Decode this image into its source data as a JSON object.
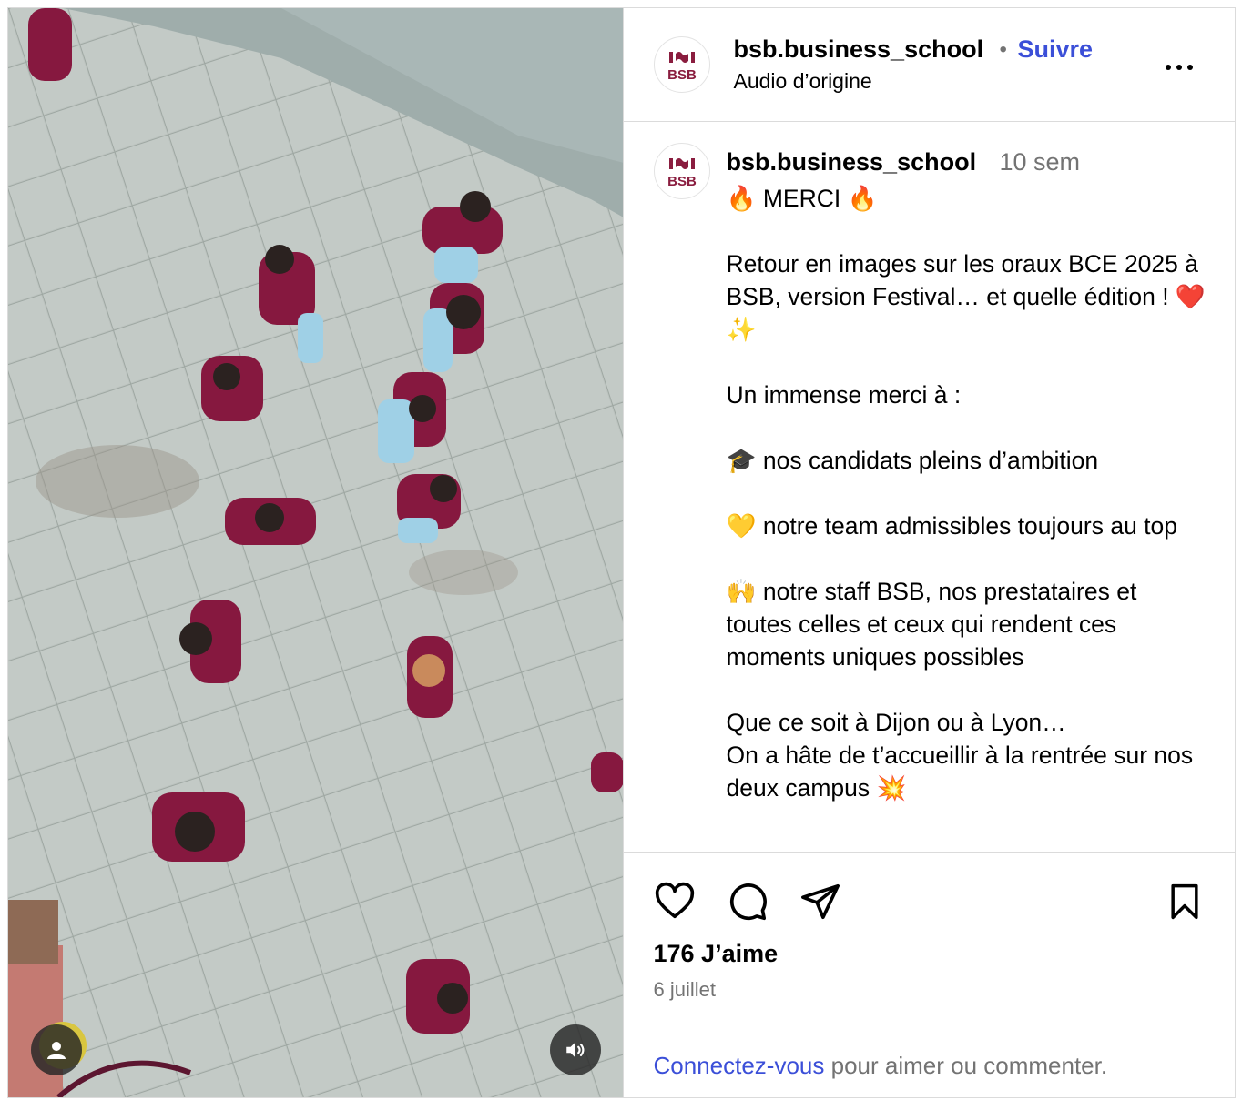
{
  "header": {
    "username": "bsb.business_school",
    "separator": "•",
    "follow_label": "Suivre",
    "audio_label": "Audio d’origine",
    "more_icon": "more-horizontal-icon"
  },
  "avatar": {
    "logo_text": "BSB",
    "brand_color": "#8a1d3f"
  },
  "caption": {
    "username": "bsb.business_school",
    "time": "10 sem",
    "text": "🔥 MERCI 🔥\n\nRetour en images sur les oraux BCE 2025 à BSB, version Festival… et quelle édition ! ❤️✨\n\nUn immense merci à :\n\n🎓 nos candidats pleins d’ambition\n\n💛 notre team admissibles toujours au top\n\n🙌 notre staff BSB, nos prestataires et toutes celles et ceux qui rendent ces moments uniques possibles\n\nQue ce soit à Dijon ou à Lyon…\nOn a hâte de t’accueillir à la rentrée sur nos deux campus 💥"
  },
  "actions": {
    "like_icon": "heart-icon",
    "comment_icon": "comment-icon",
    "share_icon": "send-icon",
    "save_icon": "bookmark-icon"
  },
  "stats": {
    "likes": "176 J’aime",
    "date": "6 juillet"
  },
  "login_prompt": {
    "link_text": "Connectez-vous",
    "rest_text": " pour aimer ou commenter."
  },
  "media": {
    "user_tag_icon": "user-icon",
    "audio_icon": "speaker-icon",
    "shirt_color": "#86183f"
  }
}
